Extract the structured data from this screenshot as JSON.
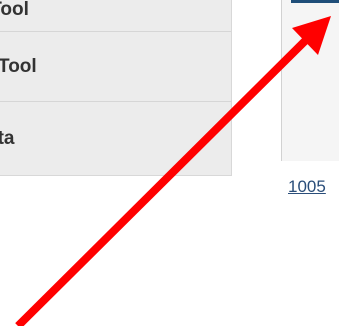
{
  "menu": {
    "items": [
      {
        "label": "er Tool"
      },
      {
        "label": "Tool"
      },
      {
        "label": "ata"
      }
    ]
  },
  "preview": {
    "link_text": "1005"
  },
  "annotation": {
    "arrow_color": "#ff0000",
    "arrow_icon": "red-pointer-arrow"
  }
}
